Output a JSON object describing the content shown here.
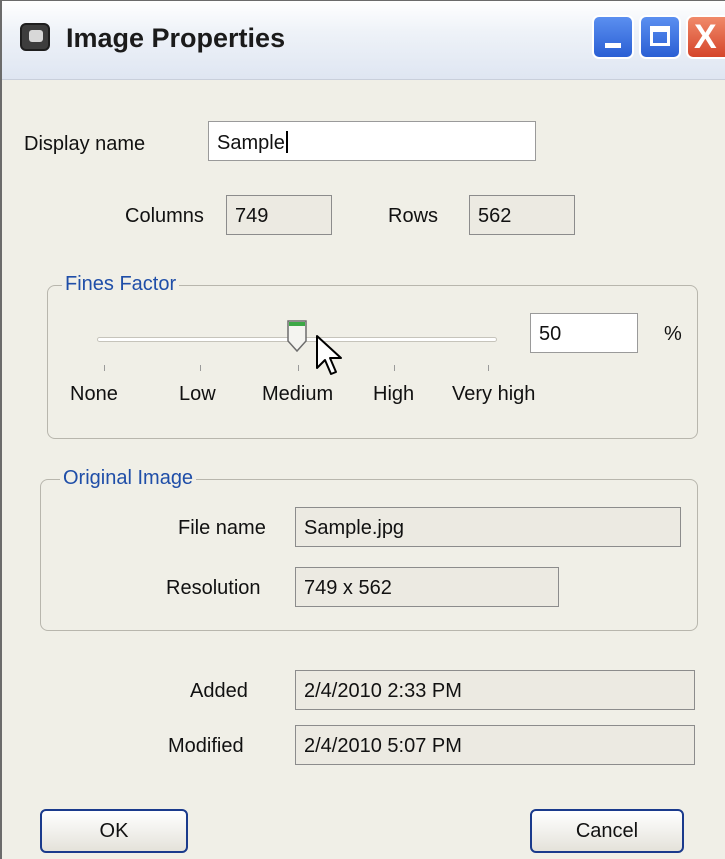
{
  "window": {
    "title": "Image Properties"
  },
  "titlebar_buttons": {
    "minimize_icon": "minimize-icon",
    "maximize_icon": "maximize-icon",
    "close_icon": "close-icon",
    "close_glyph": "X"
  },
  "display_name": {
    "label": "Display name",
    "value": "Sample"
  },
  "columns": {
    "label": "Columns",
    "value": "749"
  },
  "rows": {
    "label": "Rows",
    "value": "562"
  },
  "fines_factor": {
    "legend": "Fines Factor",
    "value": "50",
    "unit": "%",
    "slider_fraction": 0.5,
    "ticks": [
      "None",
      "Low",
      "Medium",
      "High",
      "Very high"
    ]
  },
  "original_image": {
    "legend": "Original Image",
    "file_name_label": "File name",
    "file_name": "Sample.jpg",
    "resolution_label": "Resolution",
    "resolution": "749 x 562"
  },
  "dates": {
    "added_label": "Added",
    "added": "2/4/2010 2:33 PM",
    "modified_label": "Modified",
    "modified": "2/4/2010 5:07 PM"
  },
  "buttons": {
    "ok": "OK",
    "cancel": "Cancel"
  },
  "colors": {
    "legend_blue": "#1f4ea8",
    "dialog_bg": "#f0efe7",
    "button_border": "#1a3a8c",
    "close_red": "#d5452a"
  }
}
